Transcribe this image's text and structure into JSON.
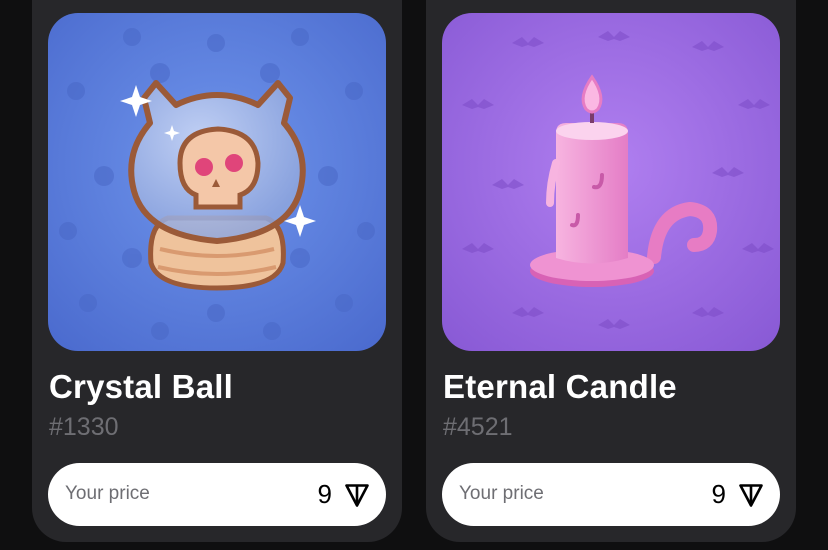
{
  "colors": {
    "page_background": "#0f0f10",
    "card_background": "#27272a",
    "crystal_ball_backdrop": "#5b7fdd",
    "eternal_candle_backdrop": "#9a6be0",
    "pill_background": "#ffffff",
    "muted_text": "#6e6e73"
  },
  "items": [
    {
      "name": "Crystal Ball",
      "number": "#1330",
      "price_label": "Your price",
      "price_value": "9",
      "currency_icon": "ton-icon",
      "artwork_icon": "crystal-ball-icon"
    },
    {
      "name": "Eternal Candle",
      "number": "#4521",
      "price_label": "Your price",
      "price_value": "9",
      "currency_icon": "ton-icon",
      "artwork_icon": "candle-icon"
    }
  ]
}
